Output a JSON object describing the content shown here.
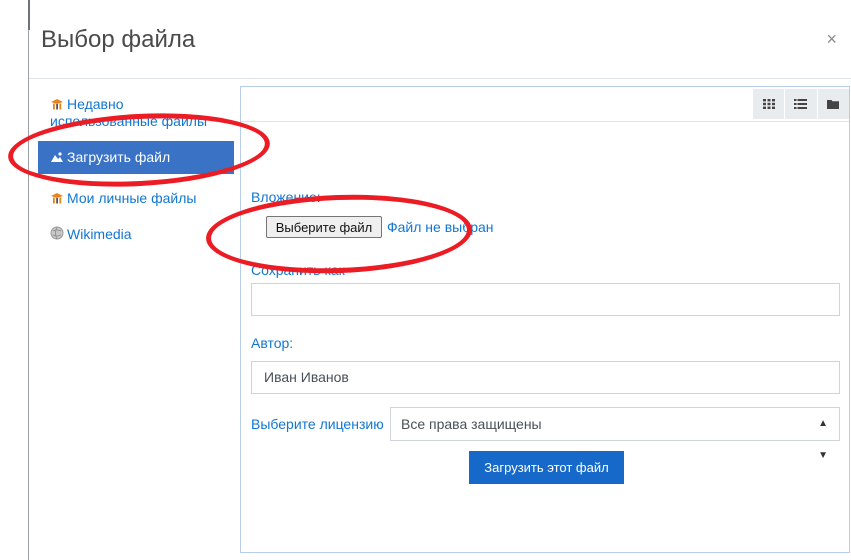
{
  "dialog": {
    "title": "Выбор файла",
    "close_glyph": "×"
  },
  "sidebar": {
    "items": [
      {
        "label_line1": "Недавно",
        "label_line2": "использованные файлы",
        "icon": "moodle-hat-icon"
      },
      {
        "label": "Загрузить файл",
        "icon": "upload-icon",
        "active": true
      },
      {
        "label": "Мои личные файлы",
        "icon": "moodle-hat-icon"
      },
      {
        "label": "Wikimedia",
        "icon": "wikimedia-globe-icon"
      }
    ]
  },
  "toolbar": {
    "views": [
      "icons-view-icon",
      "list-view-icon",
      "tree-view-icon"
    ]
  },
  "form": {
    "attachment_label": "Вложение:",
    "choose_file_label": "Выберите файл",
    "no_file_chosen": "Файл не выбран",
    "save_as_label": "Сохранить как",
    "save_as_value": "",
    "author_label": "Автор:",
    "author_value": "Иван Иванов",
    "license_label": "Выберите лицензию",
    "license_value": "Все права защищены",
    "upload_button": "Загрузить этот файл"
  },
  "colors": {
    "accent": "#1177d1",
    "active_bg": "#3a73c5",
    "button_bg": "#1669c8",
    "annotation": "#ec1c24"
  }
}
